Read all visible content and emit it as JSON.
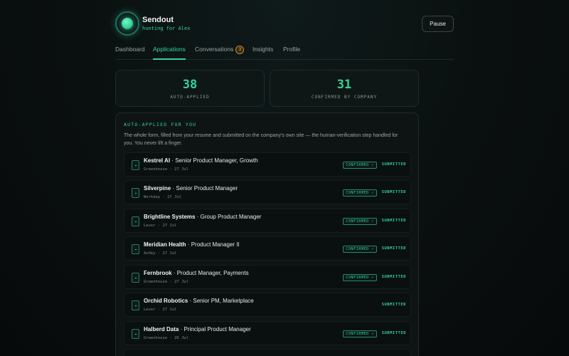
{
  "header": {
    "title": "Sendout",
    "subtitle": "hunting for Alex",
    "pause_label": "Pause"
  },
  "tabs": [
    {
      "label": "Dashboard"
    },
    {
      "label": "Applications",
      "active": true
    },
    {
      "label": "Conversations",
      "badge": "3"
    },
    {
      "label": "Insights"
    },
    {
      "label": "Profile"
    }
  ],
  "stats": [
    {
      "value": "38",
      "label": "AUTO-APPLIED"
    },
    {
      "value": "31",
      "label": "CONFIRMED BY COMPANY"
    }
  ],
  "panel": {
    "title": "AUTO-APPLIED FOR YOU",
    "description": "The whole form, filled from your resume and submitted on the company's own site — the human-verification step handled for you. You never lift a finger."
  },
  "applications": [
    {
      "company": "Kestrel AI",
      "role": "Senior Product Manager, Growth",
      "platform": "Greenhouse",
      "date": "27 Jul",
      "confirmed": "CONFIRMED ✓",
      "status": "SUBMITTED"
    },
    {
      "company": "Silverpine",
      "role": "Senior Product Manager",
      "platform": "Workday",
      "date": "27 Jul",
      "confirmed": "CONFIRMED ✓",
      "status": "SUBMITTED"
    },
    {
      "company": "Brightline Systems",
      "role": "Group Product Manager",
      "platform": "Lever",
      "date": "27 Jul",
      "confirmed": "CONFIRMED ✓",
      "status": "SUBMITTED"
    },
    {
      "company": "Meridian Health",
      "role": "Product Manager II",
      "platform": "Ashby",
      "date": "27 Jul",
      "confirmed": "CONFIRMED ✓",
      "status": "SUBMITTED"
    },
    {
      "company": "Fernbrook",
      "role": "Product Manager, Payments",
      "platform": "Greenhouse",
      "date": "27 Jul",
      "confirmed": "CONFIRMED ✓",
      "status": "SUBMITTED"
    },
    {
      "company": "Orchid Robotics",
      "role": "Senior PM, Marketplace",
      "platform": "Lever",
      "date": "27 Jul",
      "confirmed": "",
      "status": "SUBMITTED"
    },
    {
      "company": "Halberd Data",
      "role": "Principal Product Manager",
      "platform": "Greenhouse",
      "date": "26 Jul",
      "confirmed": "CONFIRMED ✓",
      "status": "SUBMITTED"
    }
  ],
  "sep": "·",
  "accent": "#34d399"
}
